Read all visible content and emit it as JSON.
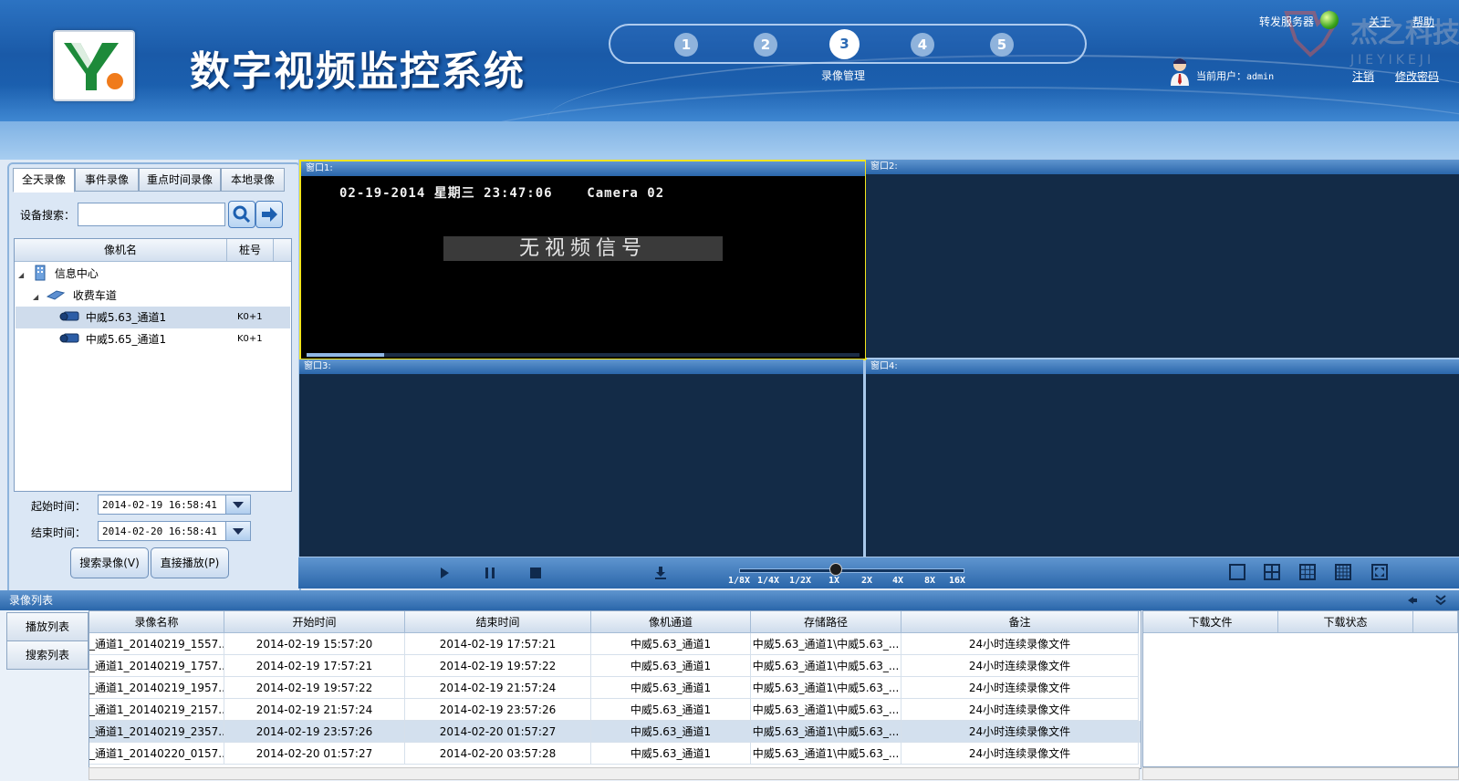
{
  "header": {
    "title": "数字视频监控系统",
    "steps": [
      "1",
      "2",
      "3",
      "4",
      "5"
    ],
    "active_step": 3,
    "active_step_label": "录像管理",
    "relay_server_label": "转发服务器",
    "about_link": "关于",
    "help_link": "帮助",
    "current_user_label": "当前用户：",
    "current_user": "admin",
    "logout_link": "注销",
    "change_password_link": "修改密码",
    "watermark_text": "杰之科技",
    "watermark_sub": "JIEYIKEJI"
  },
  "left_panel": {
    "tabs": [
      "全天录像",
      "事件录像",
      "重点时间录像",
      "本地录像"
    ],
    "active_tab": 0,
    "search_label": "设备搜索：",
    "search_value": "",
    "tree_columns": [
      "像机名",
      "桩号"
    ],
    "tree": [
      {
        "label": "信息中心",
        "level": 0,
        "stake": ""
      },
      {
        "label": "收费车道",
        "level": 1,
        "stake": ""
      },
      {
        "label": "中威5.63_通道1",
        "level": 2,
        "stake": "K0+1",
        "selected": true
      },
      {
        "label": "中威5.65_通道1",
        "level": 2,
        "stake": "K0+1"
      }
    ],
    "start_time_label": "起始时间：",
    "start_time": "2014-02-19 16:58:41",
    "end_time_label": "结束时间：",
    "end_time": "2014-02-20 16:58:41",
    "search_record_button": "搜索录像(V)",
    "direct_play_button": "直接播放(P)"
  },
  "video": {
    "windows": [
      "窗口1:",
      "窗口2:",
      "窗口3:",
      "窗口4:"
    ],
    "osd_text": "02-19-2014 星期三 23:47:06    Camera 02",
    "no_signal_text": "无视频信号",
    "window1_progress": 0.14
  },
  "controls": {
    "speeds": [
      "1/8X",
      "1/4X",
      "1/2X",
      "1X",
      "2X",
      "4X",
      "8X",
      "16X"
    ],
    "current_speed": "1X"
  },
  "record_list": {
    "title": "录像列表",
    "side_tabs": [
      "播放列表",
      "搜索列表"
    ],
    "columns": [
      "录像名称",
      "开始时间",
      "结束时间",
      "像机通道",
      "存储路径",
      "备注"
    ],
    "rows": [
      [
        "_通道1_20140219_1557...",
        "2014-02-19 15:57:20",
        "2014-02-19 17:57:21",
        "中威5.63_通道1",
        "中威5.63_通道1\\中威5.63_...",
        "24小时连续录像文件"
      ],
      [
        "_通道1_20140219_1757...",
        "2014-02-19 17:57:21",
        "2014-02-19 19:57:22",
        "中威5.63_通道1",
        "中威5.63_通道1\\中威5.63_...",
        "24小时连续录像文件"
      ],
      [
        "_通道1_20140219_1957...",
        "2014-02-19 19:57:22",
        "2014-02-19 21:57:24",
        "中威5.63_通道1",
        "中威5.63_通道1\\中威5.63_...",
        "24小时连续录像文件"
      ],
      [
        "_通道1_20140219_2157...",
        "2014-02-19 21:57:24",
        "2014-02-19 23:57:26",
        "中威5.63_通道1",
        "中威5.63_通道1\\中威5.63_...",
        "24小时连续录像文件"
      ],
      [
        "_通道1_20140219_2357...",
        "2014-02-19 23:57:26",
        "2014-02-20 01:57:27",
        "中威5.63_通道1",
        "中威5.63_通道1\\中威5.63_...",
        "24小时连续录像文件"
      ],
      [
        "_通道1_20140220_0157...",
        "2014-02-20 01:57:27",
        "2014-02-20 03:57:28",
        "中威5.63_通道1",
        "中威5.63_通道1\\中威5.63_...",
        "24小时连续录像文件"
      ]
    ],
    "selected_row": 4,
    "download_columns": [
      "下载文件",
      "下载状态"
    ]
  },
  "colors": {
    "header_blue": "#1a5aa8",
    "active_window_border": "#f2e51c",
    "video_bg": "#132b47"
  }
}
